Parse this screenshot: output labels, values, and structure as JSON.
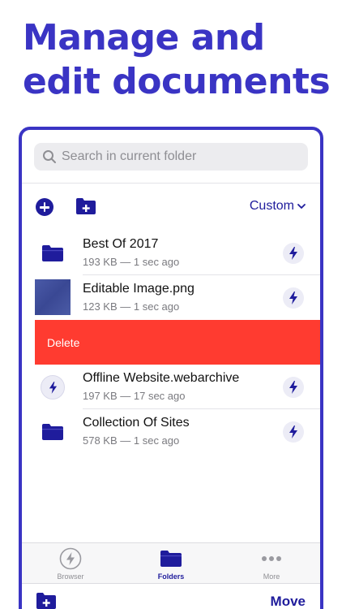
{
  "headline": "Manage and edit documents",
  "search": {
    "placeholder": "Search in current folder"
  },
  "toolbar": {
    "sort_label": "Custom"
  },
  "files": [
    {
      "name": "Best Of 2017",
      "meta": "193 KB — 1 sec ago",
      "icon": "folder-icon"
    },
    {
      "name": "Editable Image.png",
      "meta": "123 KB — 1 sec ago",
      "icon": "image-thumbnail"
    },
    {
      "name": "Offline Website.webarchive",
      "meta": "197 KB — 17 sec ago",
      "icon": "bolt-icon"
    },
    {
      "name": "Collection Of Sites",
      "meta": "578 KB — 1 sec ago",
      "icon": "folder-icon"
    }
  ],
  "swipe_action": {
    "label": "Delete",
    "color": "#ff3b30"
  },
  "tabs": [
    {
      "label": "Browser",
      "icon": "bolt-icon"
    },
    {
      "label": "Folders",
      "icon": "folder-icon",
      "active": true
    },
    {
      "label": "More",
      "icon": "more-icon"
    }
  ],
  "bottom_bar": {
    "move_label": "Move"
  },
  "colors": {
    "accent": "#1f1c9c",
    "headline": "#3a34c4",
    "destructive": "#ff3b30"
  }
}
